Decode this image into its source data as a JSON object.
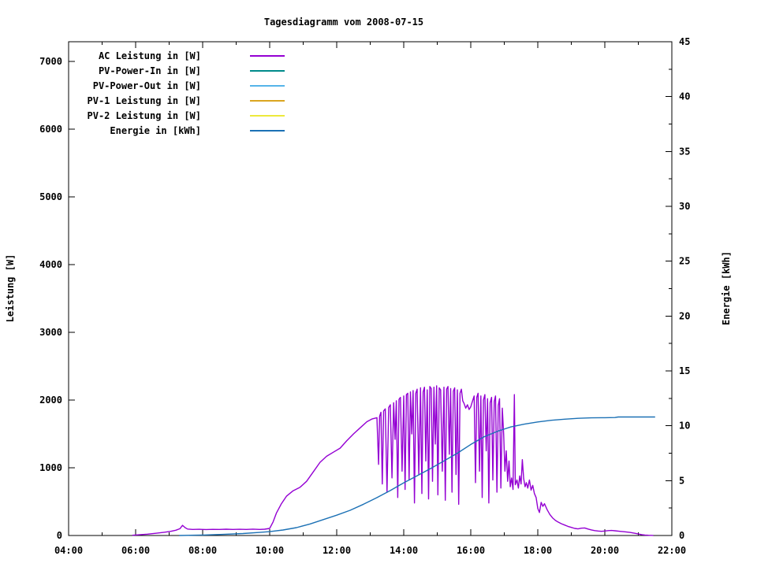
{
  "chart_data": {
    "type": "line",
    "title": "Tagesdiagramm vom 2008-07-15",
    "background": "#FFFFFF",
    "grid": false,
    "legend_position": "top-left-inside",
    "x_axis": {
      "label": "",
      "range": [
        4,
        22
      ],
      "unit": "time",
      "major_ticks": [
        {
          "t": 4,
          "label": "04:00"
        },
        {
          "t": 6,
          "label": "06:00"
        },
        {
          "t": 8,
          "label": "08:00"
        },
        {
          "t": 10,
          "label": "10:00"
        },
        {
          "t": 12,
          "label": "12:00"
        },
        {
          "t": 14,
          "label": "14:00"
        },
        {
          "t": 16,
          "label": "16:00"
        },
        {
          "t": 18,
          "label": "18:00"
        },
        {
          "t": 20,
          "label": "20:00"
        },
        {
          "t": 22,
          "label": "22:00"
        }
      ],
      "minor_ticks": [
        5,
        7,
        9,
        11,
        13,
        15,
        17,
        19,
        21
      ]
    },
    "y_left": {
      "label": "Leistung [W]",
      "range": [
        0,
        7000
      ],
      "major_ticks": [
        {
          "v": 0,
          "label": "0"
        },
        {
          "v": 1000,
          "label": "1000"
        },
        {
          "v": 2000,
          "label": "2000"
        },
        {
          "v": 3000,
          "label": "3000"
        },
        {
          "v": 4000,
          "label": "4000"
        },
        {
          "v": 5000,
          "label": "5000"
        },
        {
          "v": 6000,
          "label": "6000"
        },
        {
          "v": 7000,
          "label": "7000"
        }
      ]
    },
    "y_right": {
      "label": "Energie [kWh]",
      "range": [
        0,
        45
      ],
      "major_ticks": [
        {
          "v": 0,
          "label": "0"
        },
        {
          "v": 5,
          "label": "5"
        },
        {
          "v": 10,
          "label": "10"
        },
        {
          "v": 15,
          "label": "15"
        },
        {
          "v": 20,
          "label": "20"
        },
        {
          "v": 25,
          "label": "25"
        },
        {
          "v": 30,
          "label": "30"
        },
        {
          "v": 35,
          "label": "35"
        },
        {
          "v": 40,
          "label": "40"
        },
        {
          "v": 45,
          "label": "45"
        }
      ],
      "minor_ticks": [
        2.5,
        7.5,
        12.5,
        17.5,
        22.5,
        27.5,
        32.5,
        37.5,
        42.5
      ]
    },
    "series": [
      {
        "name": "AC Leistung in [W]",
        "color": "#9400D3",
        "axis": "left",
        "points": [
          [
            5.9,
            3
          ],
          [
            6.1,
            10
          ],
          [
            6.35,
            20
          ],
          [
            6.6,
            32
          ],
          [
            6.85,
            48
          ],
          [
            7.05,
            62
          ],
          [
            7.2,
            78
          ],
          [
            7.32,
            100
          ],
          [
            7.4,
            150
          ],
          [
            7.48,
            115
          ],
          [
            7.55,
            95
          ],
          [
            7.7,
            90
          ],
          [
            7.9,
            92
          ],
          [
            8.1,
            88
          ],
          [
            8.3,
            91
          ],
          [
            8.5,
            89
          ],
          [
            8.7,
            93
          ],
          [
            8.9,
            89
          ],
          [
            9.1,
            92
          ],
          [
            9.3,
            90
          ],
          [
            9.5,
            94
          ],
          [
            9.7,
            90
          ],
          [
            9.85,
            93
          ],
          [
            10.0,
            105
          ],
          [
            10.1,
            200
          ],
          [
            10.2,
            330
          ],
          [
            10.35,
            470
          ],
          [
            10.5,
            580
          ],
          [
            10.7,
            660
          ],
          [
            10.9,
            710
          ],
          [
            11.1,
            800
          ],
          [
            11.3,
            940
          ],
          [
            11.5,
            1080
          ],
          [
            11.7,
            1170
          ],
          [
            11.9,
            1230
          ],
          [
            12.1,
            1290
          ],
          [
            12.3,
            1400
          ],
          [
            12.5,
            1500
          ],
          [
            12.7,
            1590
          ],
          [
            12.9,
            1680
          ],
          [
            13.05,
            1720
          ],
          [
            13.2,
            1740
          ],
          [
            13.25,
            1050
          ],
          [
            13.28,
            1760
          ],
          [
            13.32,
            1820
          ],
          [
            13.36,
            760
          ],
          [
            13.4,
            1840
          ],
          [
            13.45,
            1870
          ],
          [
            13.5,
            640
          ],
          [
            13.55,
            1890
          ],
          [
            13.6,
            1930
          ],
          [
            13.65,
            850
          ],
          [
            13.7,
            1960
          ],
          [
            13.74,
            1420
          ],
          [
            13.78,
            1990
          ],
          [
            13.82,
            560
          ],
          [
            13.86,
            2010
          ],
          [
            13.9,
            2040
          ],
          [
            13.95,
            950
          ],
          [
            14.0,
            2060
          ],
          [
            14.04,
            680
          ],
          [
            14.08,
            2080
          ],
          [
            14.12,
            2100
          ],
          [
            14.16,
            820
          ],
          [
            14.2,
            2120
          ],
          [
            14.24,
            1500
          ],
          [
            14.28,
            2140
          ],
          [
            14.32,
            480
          ],
          [
            14.36,
            2100
          ],
          [
            14.4,
            2160
          ],
          [
            14.45,
            900
          ],
          [
            14.5,
            2180
          ],
          [
            14.54,
            620
          ],
          [
            14.58,
            2120
          ],
          [
            14.62,
            2190
          ],
          [
            14.66,
            1100
          ],
          [
            14.7,
            2150
          ],
          [
            14.74,
            540
          ],
          [
            14.78,
            2200
          ],
          [
            14.82,
            2170
          ],
          [
            14.86,
            800
          ],
          [
            14.9,
            2190
          ],
          [
            14.94,
            1350
          ],
          [
            14.98,
            2210
          ],
          [
            15.02,
            600
          ],
          [
            15.06,
            2180
          ],
          [
            15.1,
            2150
          ],
          [
            15.15,
            950
          ],
          [
            15.2,
            2190
          ],
          [
            15.24,
            520
          ],
          [
            15.28,
            2160
          ],
          [
            15.32,
            2200
          ],
          [
            15.36,
            1200
          ],
          [
            15.4,
            2170
          ],
          [
            15.44,
            640
          ],
          [
            15.48,
            2130
          ],
          [
            15.52,
            2180
          ],
          [
            15.56,
            900
          ],
          [
            15.6,
            2150
          ],
          [
            15.64,
            460
          ],
          [
            15.68,
            2100
          ],
          [
            15.72,
            2160
          ],
          [
            15.76,
            1990
          ],
          [
            15.8,
            1950
          ],
          [
            15.85,
            1880
          ],
          [
            15.9,
            1930
          ],
          [
            15.95,
            1860
          ],
          [
            16.0,
            1900
          ],
          [
            16.05,
            1980
          ],
          [
            16.1,
            2060
          ],
          [
            16.14,
            780
          ],
          [
            16.18,
            2040
          ],
          [
            16.22,
            2100
          ],
          [
            16.26,
            950
          ],
          [
            16.3,
            2060
          ],
          [
            16.34,
            560
          ],
          [
            16.38,
            2000
          ],
          [
            16.42,
            2080
          ],
          [
            16.46,
            1250
          ],
          [
            16.5,
            2020
          ],
          [
            16.54,
            480
          ],
          [
            16.58,
            1960
          ],
          [
            16.62,
            2040
          ],
          [
            16.66,
            820
          ],
          [
            16.7,
            1980
          ],
          [
            16.74,
            2060
          ],
          [
            16.78,
            640
          ],
          [
            16.82,
            1920
          ],
          [
            16.86,
            2020
          ],
          [
            16.9,
            700
          ],
          [
            16.94,
            1880
          ],
          [
            16.98,
            1500
          ],
          [
            17.02,
            950
          ],
          [
            17.06,
            1250
          ],
          [
            17.1,
            800
          ],
          [
            17.14,
            1100
          ],
          [
            17.18,
            720
          ],
          [
            17.22,
            850
          ],
          [
            17.26,
            680
          ],
          [
            17.3,
            2080
          ],
          [
            17.33,
            750
          ],
          [
            17.38,
            820
          ],
          [
            17.42,
            700
          ],
          [
            17.46,
            880
          ],
          [
            17.5,
            760
          ],
          [
            17.54,
            1120
          ],
          [
            17.58,
            840
          ],
          [
            17.62,
            720
          ],
          [
            17.66,
            780
          ],
          [
            17.7,
            700
          ],
          [
            17.75,
            820
          ],
          [
            17.8,
            670
          ],
          [
            17.85,
            740
          ],
          [
            17.9,
            620
          ],
          [
            17.95,
            560
          ],
          [
            18.0,
            400
          ],
          [
            18.05,
            340
          ],
          [
            18.1,
            490
          ],
          [
            18.15,
            430
          ],
          [
            18.2,
            470
          ],
          [
            18.28,
            380
          ],
          [
            18.36,
            310
          ],
          [
            18.44,
            260
          ],
          [
            18.52,
            225
          ],
          [
            18.6,
            200
          ],
          [
            18.7,
            175
          ],
          [
            18.8,
            155
          ],
          [
            18.9,
            135
          ],
          [
            19.0,
            120
          ],
          [
            19.1,
            105
          ],
          [
            19.2,
            98
          ],
          [
            19.3,
            108
          ],
          [
            19.4,
            112
          ],
          [
            19.5,
            95
          ],
          [
            19.6,
            82
          ],
          [
            19.7,
            72
          ],
          [
            19.8,
            66
          ],
          [
            19.9,
            62
          ],
          [
            20.0,
            66
          ],
          [
            20.1,
            72
          ],
          [
            20.2,
            74
          ],
          [
            20.3,
            70
          ],
          [
            20.45,
            62
          ],
          [
            20.6,
            55
          ],
          [
            20.75,
            45
          ],
          [
            20.9,
            32
          ],
          [
            21.0,
            22
          ],
          [
            21.1,
            13
          ],
          [
            21.2,
            7
          ],
          [
            21.3,
            3
          ],
          [
            21.45,
            1
          ]
        ]
      },
      {
        "name": "PV-Power-In in [W]",
        "color": "#008B8B",
        "axis": "left",
        "points": []
      },
      {
        "name": "PV-Power-Out in [W]",
        "color": "#56B4E9",
        "axis": "left",
        "points": []
      },
      {
        "name": "PV-1 Leistung in [W]",
        "color": "#DAA520",
        "axis": "left",
        "points": []
      },
      {
        "name": "PV-2 Leistung in [W]",
        "color": "#EDE93C",
        "axis": "left",
        "points": []
      },
      {
        "name": "Energie in [kWh]",
        "color": "#1C71B5",
        "axis": "right",
        "points": [
          [
            7.3,
            0.0
          ],
          [
            8.0,
            0.04
          ],
          [
            8.6,
            0.1
          ],
          [
            9.2,
            0.18
          ],
          [
            9.7,
            0.28
          ],
          [
            10.0,
            0.35
          ],
          [
            10.4,
            0.5
          ],
          [
            10.8,
            0.72
          ],
          [
            11.2,
            1.05
          ],
          [
            11.6,
            1.45
          ],
          [
            12.0,
            1.85
          ],
          [
            12.4,
            2.3
          ],
          [
            12.8,
            2.85
          ],
          [
            13.2,
            3.45
          ],
          [
            13.6,
            4.1
          ],
          [
            14.0,
            4.8
          ],
          [
            14.4,
            5.45
          ],
          [
            14.8,
            6.1
          ],
          [
            15.2,
            6.8
          ],
          [
            15.6,
            7.5
          ],
          [
            16.0,
            8.3
          ],
          [
            16.4,
            9.0
          ],
          [
            16.8,
            9.5
          ],
          [
            17.2,
            9.9
          ],
          [
            17.6,
            10.15
          ],
          [
            18.0,
            10.35
          ],
          [
            18.4,
            10.5
          ],
          [
            18.8,
            10.6
          ],
          [
            19.2,
            10.68
          ],
          [
            19.6,
            10.72
          ],
          [
            20.0,
            10.74
          ],
          [
            20.3,
            10.75
          ],
          [
            20.4,
            10.8
          ],
          [
            20.8,
            10.8
          ],
          [
            21.3,
            10.8
          ],
          [
            21.5,
            10.8
          ]
        ]
      }
    ]
  }
}
